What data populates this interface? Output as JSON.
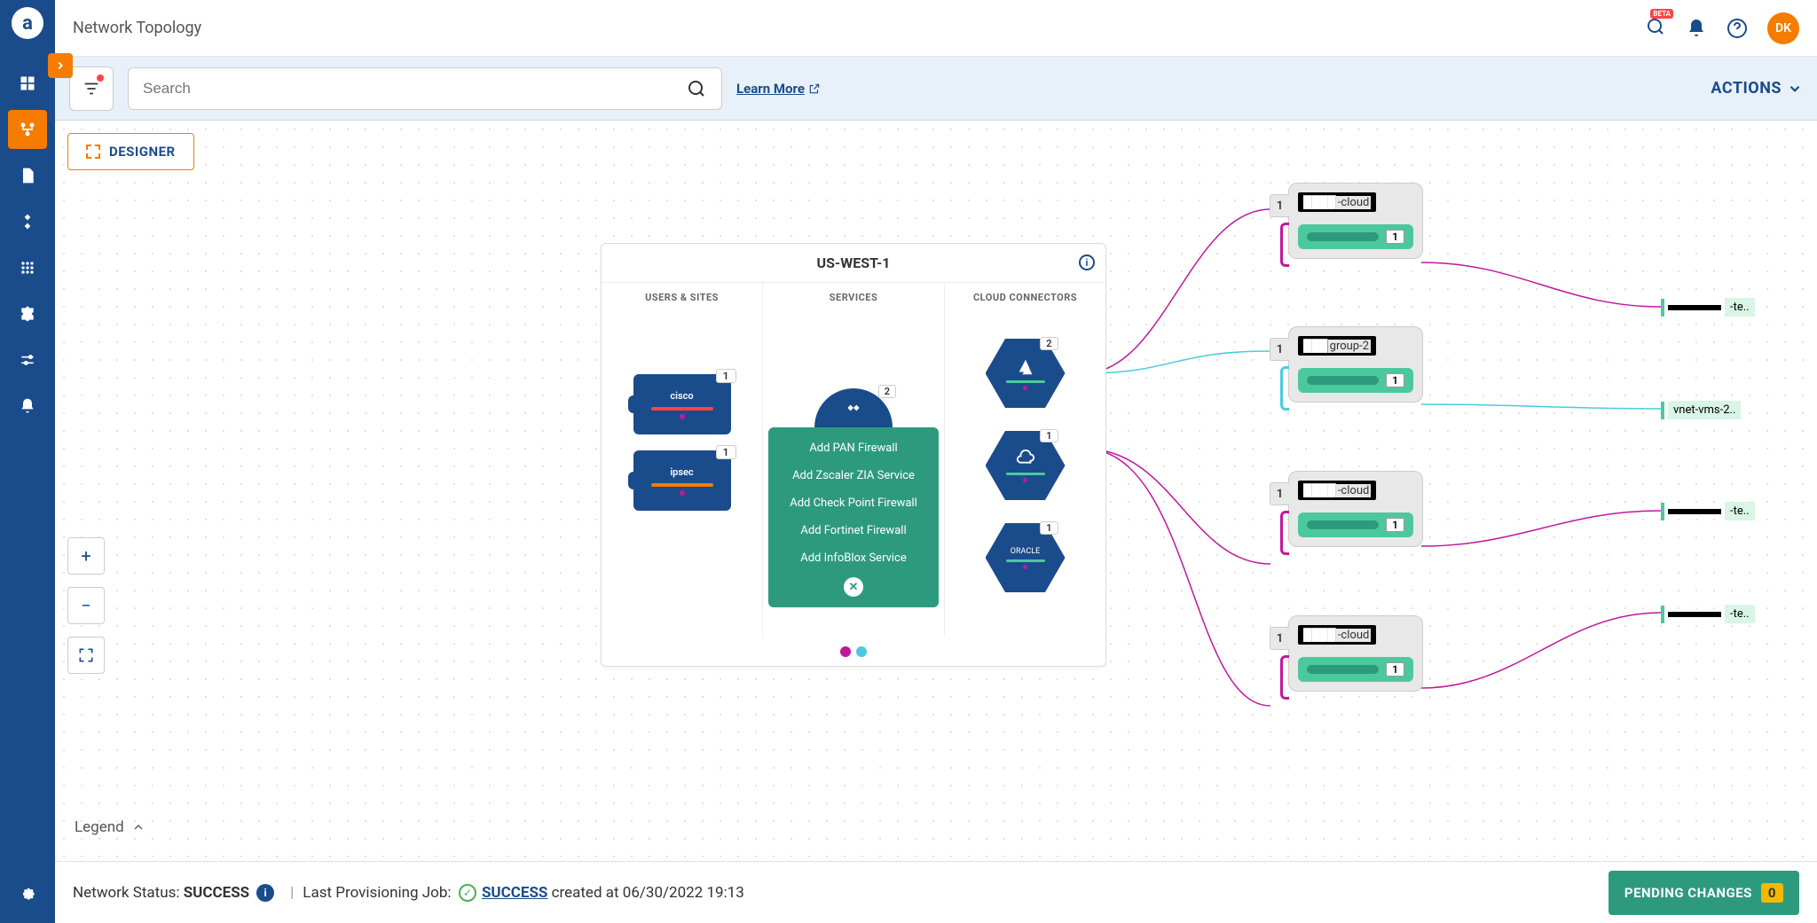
{
  "header": {
    "title": "Network Topology",
    "beta": "BETA",
    "avatar": "DK"
  },
  "toolbar": {
    "search_placeholder": "Search",
    "learn_more": "Learn More",
    "actions": "ACTIONS"
  },
  "designer": "DESIGNER",
  "legend": "Legend",
  "region": {
    "title": "US-WEST-1",
    "columns": {
      "users": "USERS & SITES",
      "services": "SERVICES",
      "connectors": "CLOUD CONNECTORS"
    },
    "user_nodes": [
      {
        "label": "cisco",
        "badge": "1",
        "bar": "red"
      },
      {
        "label": "ipsec",
        "badge": "1",
        "bar": "orange"
      }
    ],
    "service_top_badge": "2",
    "service_menu": [
      "Add PAN Firewall",
      "Add Zscaler ZIA Service",
      "Add Check Point Firewall",
      "Add Fortinet Firewall",
      "Add InfoBlox Service"
    ],
    "connectors": [
      {
        "type": "azure",
        "badge": "2"
      },
      {
        "type": "cloud",
        "badge": "1"
      },
      {
        "type": "oracle",
        "badge": "1"
      }
    ]
  },
  "groups": [
    {
      "tab": "1",
      "label_suffix": "-cloud",
      "inner_badge": "1",
      "bracket": "magenta"
    },
    {
      "tab": "1",
      "label_suffix": "group-2",
      "inner_badge": "1",
      "bracket": "cyan"
    },
    {
      "tab": "1",
      "label_suffix": "-cloud",
      "inner_badge": "1",
      "bracket": "magenta"
    },
    {
      "tab": "1",
      "label_suffix": "-cloud",
      "inner_badge": "1",
      "bracket": "magenta"
    }
  ],
  "endpoints": [
    "-te..",
    "vnet-vms-2..",
    "-te..",
    "-te.."
  ],
  "footer": {
    "status_label": "Network Status:",
    "status_value": "SUCCESS",
    "last_job_label": "Last Provisioning Job:",
    "last_job_status": "SUCCESS",
    "last_job_time": "created at 06/30/2022 19:13",
    "pending_label": "PENDING CHANGES",
    "pending_count": "0"
  }
}
